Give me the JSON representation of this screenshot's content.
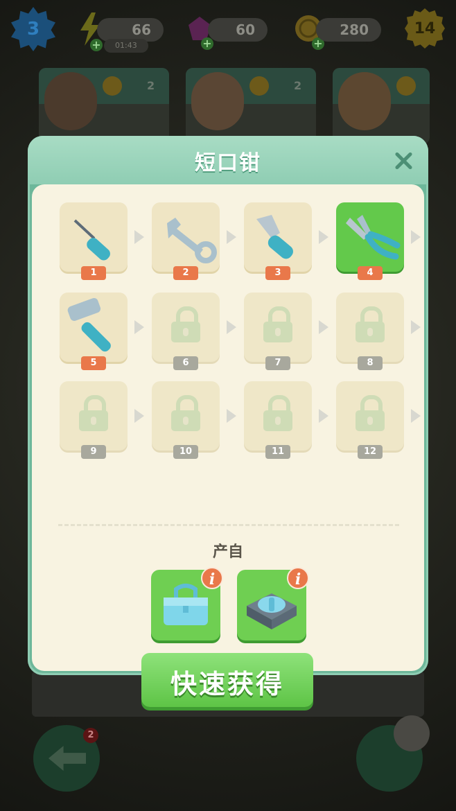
{
  "topbar": {
    "level": "3",
    "energy": {
      "value": "66",
      "timer": "01:43",
      "icon": "lightning-icon"
    },
    "gems": {
      "value": "60",
      "icon": "gem-icon"
    },
    "coins": {
      "value": "280",
      "icon": "coin-icon"
    },
    "xp_level": "14"
  },
  "orders": [
    {
      "count": "2"
    },
    {
      "count": "2"
    },
    {
      "count": ""
    }
  ],
  "modal": {
    "title": "短口钳",
    "chain": [
      {
        "num": "1",
        "item": "screwdriver-icon",
        "state": "unlocked"
      },
      {
        "num": "2",
        "item": "wrench-icon",
        "state": "unlocked"
      },
      {
        "num": "3",
        "item": "putty-knife-icon",
        "state": "unlocked"
      },
      {
        "num": "4",
        "item": "pliers-icon",
        "state": "current"
      },
      {
        "num": "5",
        "item": "hammer-icon",
        "state": "unlocked"
      },
      {
        "num": "6",
        "item": "lock-icon",
        "state": "locked"
      },
      {
        "num": "7",
        "item": "lock-icon",
        "state": "locked"
      },
      {
        "num": "8",
        "item": "lock-icon",
        "state": "locked"
      },
      {
        "num": "9",
        "item": "lock-icon",
        "state": "locked"
      },
      {
        "num": "10",
        "item": "lock-icon",
        "state": "locked"
      },
      {
        "num": "11",
        "item": "lock-icon",
        "state": "locked"
      },
      {
        "num": "12",
        "item": "lock-icon",
        "state": "locked"
      }
    ],
    "source_label": "产自",
    "sources": [
      {
        "icon": "toolbox-icon",
        "info": "i"
      },
      {
        "icon": "tool-crate-icon",
        "info": "i"
      }
    ],
    "quick_button": "快速获得"
  },
  "bottom": {
    "back_badge": "2"
  },
  "colors": {
    "accent_green": "#63c94b",
    "label_orange": "#e9784a",
    "label_gray": "#a8a89d",
    "panel": "#f8f3e1"
  }
}
